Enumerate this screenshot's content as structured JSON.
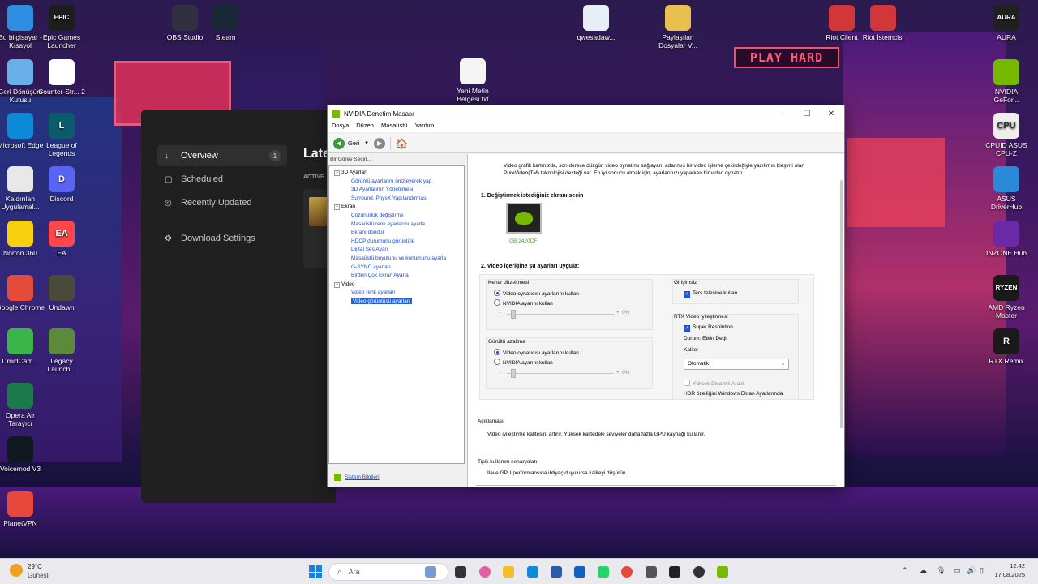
{
  "desktop": {
    "icons_left": [
      {
        "label": "Bu bilgisayar - Kısayol",
        "color": "#2d8de0"
      },
      {
        "label": "Geri Dönüşüm Kutusu",
        "color": "#6ab0e8"
      },
      {
        "label": "Microsoft Edge",
        "color": "#0c8ad8"
      },
      {
        "label": "Kaldırılan Uygulamal...",
        "color": "#e8e8e8"
      },
      {
        "label": "Norton 360",
        "color": "#f7d10e"
      },
      {
        "label": "Google Chrome",
        "color": "#e44b3a"
      },
      {
        "label": "DroidCam...",
        "color": "#3ab54a"
      },
      {
        "label": "Opera Air Tarayıcı",
        "color": "#1b7a4a"
      },
      {
        "label": "Voicemod V3",
        "color": "#101820"
      },
      {
        "label": "PlanetVPN",
        "color": "#e8473c"
      }
    ],
    "icons_left2": [
      {
        "label": "Epic Games Launcher",
        "color": "#1d1d1d",
        "glyph": "EPIC"
      },
      {
        "label": "Counter-Str... 2",
        "color": "#ffffff",
        "glyph": ""
      },
      {
        "label": "League of Legends",
        "color": "#0a5c6a",
        "glyph": "L"
      },
      {
        "label": "Discord",
        "color": "#5865f2",
        "glyph": "D"
      },
      {
        "label": "EA",
        "color": "#ff4747",
        "glyph": "EA"
      },
      {
        "label": "Undawn",
        "color": "#4a4a3a",
        "glyph": ""
      },
      {
        "label": "Legacy Launch...",
        "color": "#5a8a3a",
        "glyph": ""
      }
    ],
    "icons_top": [
      {
        "label": "OBS Studio",
        "color": "#303040"
      },
      {
        "label": "Steam",
        "color": "#1b2838"
      }
    ],
    "icons_mid": [
      {
        "label": "qwesadaw...",
        "color": "#e8eef8"
      },
      {
        "label": "Yeni Metin Belgesi.txt",
        "color": "#f5f5f5"
      },
      {
        "label": "Paylaşılan Dosyalar V...",
        "color": "#e8c050"
      }
    ],
    "icons_riot": [
      {
        "label": "Riot Client",
        "color": "#d13639"
      },
      {
        "label": "Riot İstemcisi",
        "color": "#d13639"
      }
    ],
    "icons_right": [
      {
        "label": "AURA",
        "color": "#202020",
        "glyph": "AURA"
      },
      {
        "label": "NVIDIA GeFor...",
        "color": "#76b900",
        "glyph": ""
      },
      {
        "label": "CPUID ASUS CPU-Z",
        "color": "#eeeeee",
        "glyph": "CPU"
      },
      {
        "label": "ASUS DriverHub",
        "color": "#2a8ad8",
        "glyph": ""
      },
      {
        "label": "INZONE Hub",
        "color": "#6a2aa8",
        "glyph": ""
      },
      {
        "label": "AMD Ryzen Master",
        "color": "#1a1a1a",
        "glyph": "RYZEN"
      },
      {
        "label": "RTX Remix",
        "color": "#1a1a1a",
        "glyph": "R"
      }
    ],
    "wall_sign": "PLAY HARD"
  },
  "launcher": {
    "nav": [
      {
        "label": "Overview",
        "glyph": "↓",
        "badge": "1"
      },
      {
        "label": "Scheduled",
        "glyph": "▢",
        "badge": ""
      },
      {
        "label": "Recently Updated",
        "glyph": "◎",
        "badge": ""
      },
      {
        "label": "Download Settings",
        "glyph": "⚙",
        "badge": ""
      }
    ],
    "heading": "Late",
    "active_label": "ACTIVE"
  },
  "nvidia": {
    "title": "NVIDIA Denetim Masası",
    "menu": [
      "Dosya",
      "Düzen",
      "Masaüstü",
      "Yardım"
    ],
    "back_label": "Geri",
    "task_header": "Bir Görev Seçin...",
    "tree": [
      {
        "text": "3D Ayarları",
        "kind": "cat",
        "indent": 0,
        "toggle": "−"
      },
      {
        "text": "Görüntü ayarlarını önizleyerek yap",
        "kind": "lnk",
        "indent": 1
      },
      {
        "text": "3D Ayarlarının Yönetilmesi",
        "kind": "lnk",
        "indent": 1
      },
      {
        "text": "Surround, PhysX Yapılandırması",
        "kind": "lnk",
        "indent": 1
      },
      {
        "text": "Ekran",
        "kind": "cat",
        "indent": 0,
        "toggle": "−"
      },
      {
        "text": "Çözünürlük değiştirme",
        "kind": "lnk",
        "indent": 1
      },
      {
        "text": "Masaüstü renk ayarlarını ayarla",
        "kind": "lnk",
        "indent": 1
      },
      {
        "text": "Ekranı döndür",
        "kind": "lnk",
        "indent": 1
      },
      {
        "text": "HDCP durumunu görüntüle",
        "kind": "lnk",
        "indent": 1
      },
      {
        "text": "Dijital Ses Ayarı",
        "kind": "lnk",
        "indent": 1
      },
      {
        "text": "Masaüstü boyutunu ve konumunu ayarla",
        "kind": "lnk",
        "indent": 1
      },
      {
        "text": "G-SYNC ayarları",
        "kind": "lnk",
        "indent": 1
      },
      {
        "text": "Birden Çok Ekran Ayarla",
        "kind": "lnk",
        "indent": 1
      },
      {
        "text": "Video",
        "kind": "cat",
        "indent": 0,
        "toggle": "−"
      },
      {
        "text": "Video renk ayarları",
        "kind": "lnk",
        "indent": 1
      },
      {
        "text": "Video görüntüsü ayarları",
        "kind": "sel",
        "indent": 1
      }
    ],
    "system_info": "Sistem Bilgileri",
    "intro_1": "Video grafik kartınızda, son derece düzgün video oynatımı sağlayan, adanmış bir video işleme çekirdeğiyle yazılımın bieşimi olan",
    "intro_2": "PureVideo(TM) teknolojisi desteği var. En iyi sonucu almak için, ayarlarınızı yaparken bir video oynatın.",
    "step1": "1. Değiştirmek istediğiniz ekranı seçin",
    "gpu_label": "GB 2420CF",
    "step2": "2. Video içeriğine şu ayarları uygula:",
    "edge": {
      "title": "Kenar düzeltmesi",
      "opt1": "Video oynatıcısı ayarlarını kullan",
      "opt2": "NVIDIA ayarını kullan",
      "value": "0%"
    },
    "noise": {
      "title": "Gürültü azaltma",
      "opt1": "Video oynatıcısı ayarlarını kullan",
      "opt2": "NVIDIA ayarını kullan",
      "value": "0%"
    },
    "interlace": {
      "title": "Girişimsiz",
      "check": "Ters telesine kullan"
    },
    "rtx": {
      "title": "RTX Video iyileştirmesi",
      "super_res": "Super Resolution",
      "status": "Durum: Etkin Değil",
      "quality_label": "Kalite:",
      "quality_value": "Otomatik",
      "hdr": "Yüksek Dinamik Aralık",
      "hdr_note": "HDR özelliğini Windows Ekran Ayarlarında"
    },
    "desc_title": "Açıklaması:",
    "desc_text": "Video iyileştirme kalitesini artırır.  Yüksek kalitedeki seviyeler daha fazla GPU kaynağı kullanır.",
    "usage_title": "Tipik kullanım senaryoları:",
    "usage_text": "İlave GPU performansına ihtiyaç duyulursa kaliteyi düşürün."
  },
  "taskbar": {
    "weather_temp": "29°C",
    "weather_desc": "Güneşli",
    "search_placeholder": "Ara",
    "time": "12:42",
    "date": "17.08.2025"
  }
}
